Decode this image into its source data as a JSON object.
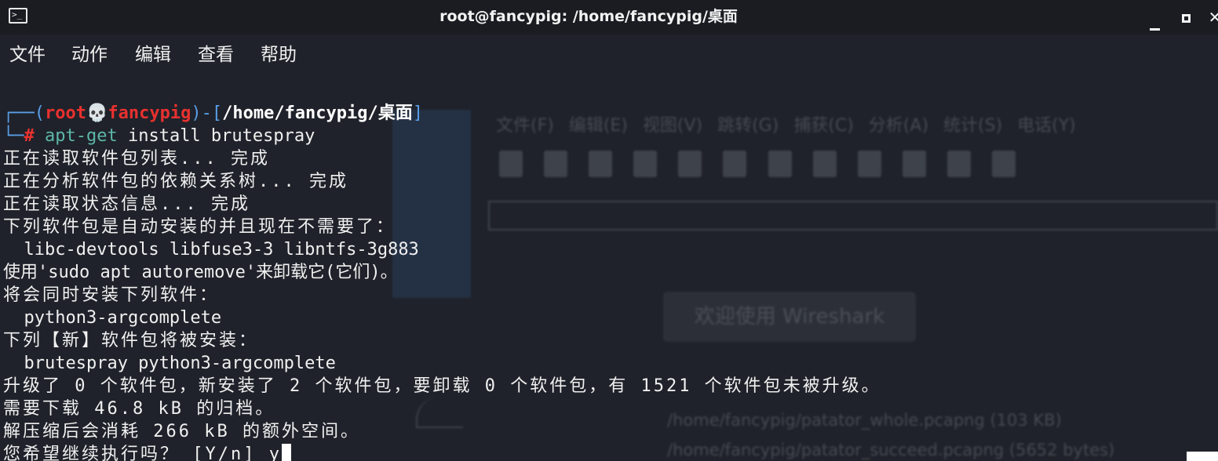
{
  "window": {
    "title": "root@fancypig: /home/fancypig/桌面",
    "icon": "terminal-icon"
  },
  "menu": {
    "items": [
      "文件",
      "动作",
      "编辑",
      "查看",
      "帮助"
    ]
  },
  "prompt": {
    "open": "┌──(",
    "user": "root",
    "skull": "💀",
    "host": "fancypig",
    "mid": ")-[",
    "path": "/home/fancypig/桌面",
    "close": "]",
    "lead": "└─",
    "hash": "#",
    "command_word": "apt-get",
    "command_rest": " install brutespray"
  },
  "output": {
    "lines": [
      "正在读取软件包列表... 完成",
      "正在分析软件包的依赖关系树... 完成",
      "正在读取状态信息... 完成",
      "下列软件包是自动安装的并且现在不需要了：",
      "  libc-devtools libfuse3-3 libntfs-3g883",
      "使用'sudo apt autoremove'来卸载它(它们)。",
      "将会同时安装下列软件：",
      "  python3-argcomplete",
      "下列【新】软件包将被安装：",
      "  brutespray python3-argcomplete",
      "升级了 0 个软件包，新安装了 2 个软件包，要卸载 0 个软件包，有 1521 个软件包未被升级。",
      "需要下载 46.8 kB 的归档。",
      "解压缩后会消耗 266 kB 的额外空间。",
      "您希望继续执行吗？ [Y/n] y"
    ]
  },
  "background_window": {
    "menu": "文件(F) 编辑(E) 视图(V) 跳转(G) 捕获(C) 分析(A) 统计(S) 电话(Y)",
    "welcome": "欢迎使用 Wireshark",
    "files": [
      "/home/fancypig/patator_whole.pcapng (103 KB)",
      "/home/fancypig/patator_succeed.pcapng (5652 bytes)"
    ]
  },
  "colors": {
    "background": "#1f222a",
    "prompt_blue": "#5a9ee8",
    "prompt_red": "#e8312f",
    "command_teal": "#5db7a9"
  }
}
